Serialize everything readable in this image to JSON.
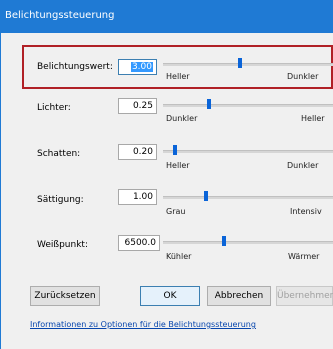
{
  "window": {
    "title": "Belichtungssteuerung"
  },
  "controls": [
    {
      "label": "Belichtungswert:",
      "value": "3.00",
      "left": "Heller",
      "right": "Dunkler",
      "level": 0.46,
      "selected": true
    },
    {
      "label": "Lichter:",
      "value": "0.25",
      "left": "Dunkler",
      "right": "Heller",
      "level": 0.25,
      "selected": false
    },
    {
      "label": "Schatten:",
      "value": "0.20",
      "left": "Heller",
      "right": "Dunkler",
      "level": 0.02,
      "selected": false
    },
    {
      "label": "Sättigung:",
      "value": "1.00",
      "left": "Grau",
      "right": "Intensiv",
      "level": 0.23,
      "selected": false
    },
    {
      "label": "Weißpunkt:",
      "value": "6500.0",
      "left": "Kühler",
      "right": "Wärmer",
      "level": 0.35,
      "selected": false
    }
  ],
  "buttons": {
    "reset": "Zurücksetzen",
    "ok": "OK",
    "cancel": "Abbrechen",
    "apply": "Übernehmen"
  },
  "help_link": "Informationen zu Optionen für die Belichtungssteuerung",
  "colors": {
    "titlebar": "#1f7ad4",
    "slider_thumb": "#0a64d8",
    "highlight": "#b02026"
  }
}
